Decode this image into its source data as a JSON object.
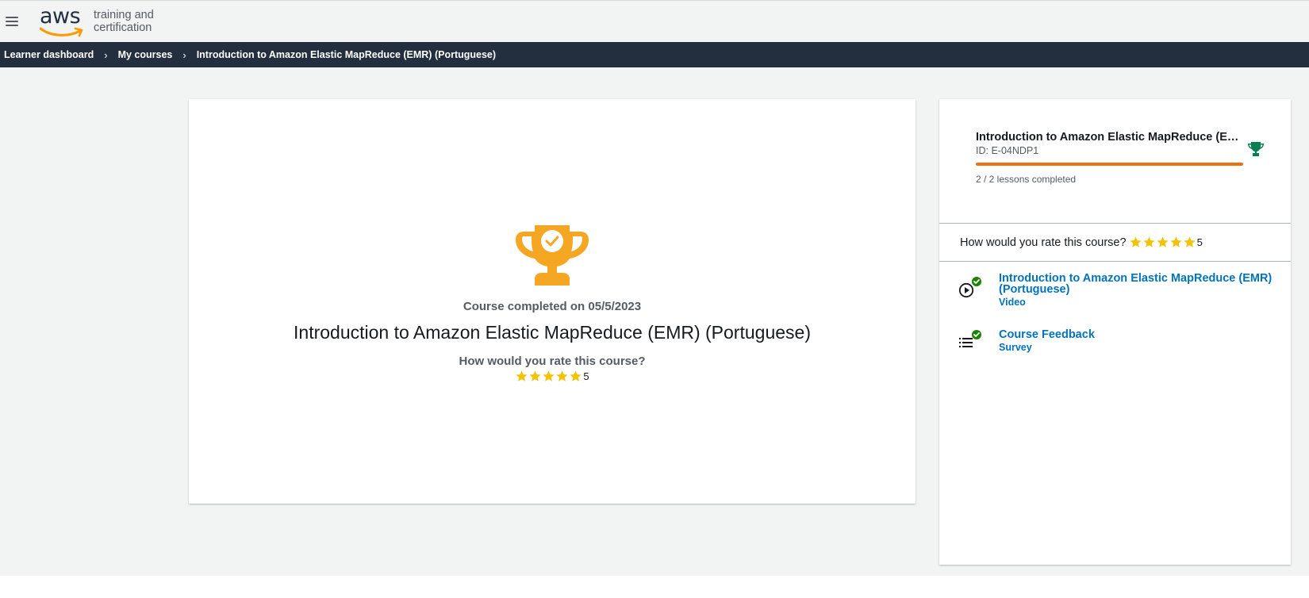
{
  "header": {
    "logo_text": "aws",
    "logo_sub_line1": "training and",
    "logo_sub_line2": "certification"
  },
  "breadcrumb": {
    "items": [
      "Learner dashboard",
      "My courses",
      "Introduction to Amazon Elastic MapReduce (EMR) (Portuguese)"
    ],
    "separator": "›"
  },
  "completion": {
    "completed_text": "Course completed on 05/5/2023",
    "course_title": "Introduction to Amazon Elastic MapReduce (EMR) (Portuguese)",
    "rate_question": "How would you rate this course?",
    "rating": "5",
    "stars_filled": 5,
    "stars_total": 5
  },
  "side_panel": {
    "course_title": "Introduction to Amazon Elastic MapReduce (EMR) (Portuguese)",
    "course_id": "ID: E-04NDP1",
    "progress_fraction": 1.0,
    "lessons_completed": "2 / 2 lessons completed",
    "rate_question": "How would you rate this course?",
    "rating": "5",
    "lessons": [
      {
        "title": "Introduction to Amazon Elastic MapReduce (EMR) (Portuguese)",
        "type": "Video",
        "icon": "play-circle-icon",
        "status": "completed"
      },
      {
        "title": "Course Feedback",
        "type": "Survey",
        "icon": "list-icon",
        "status": "completed"
      }
    ]
  },
  "colors": {
    "accent_orange": "#ec7211",
    "trophy_orange": "#f5a623",
    "trophy_green": "#037f51",
    "check_green": "#1d8102",
    "link_blue": "#0073bb",
    "star_yellow": "#f2c300",
    "nav_dark": "#232f3e"
  }
}
